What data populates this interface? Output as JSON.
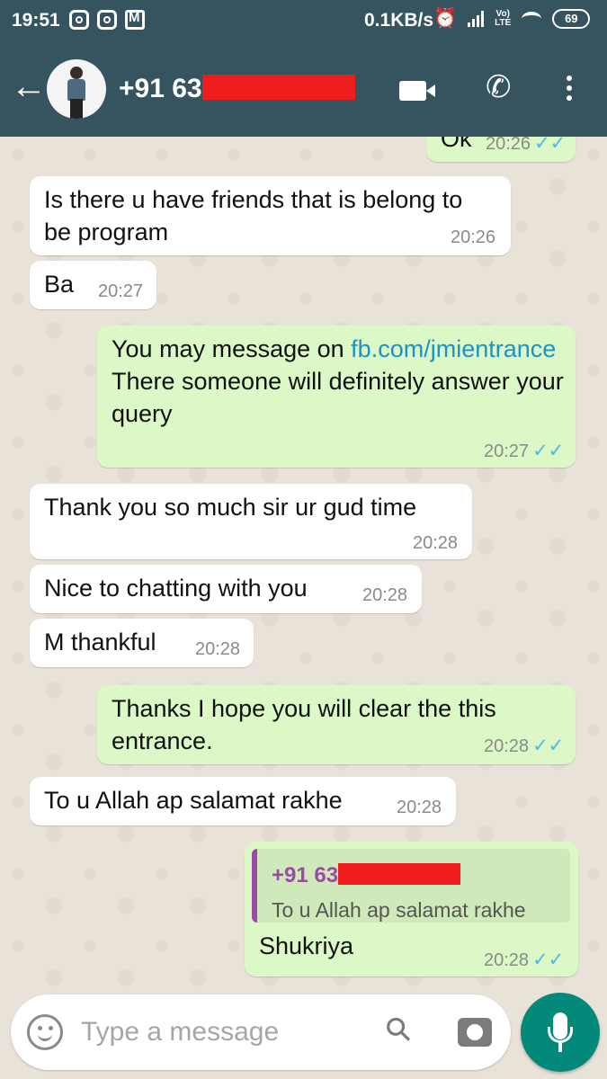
{
  "status_bar": {
    "time": "19:51",
    "network_speed": "0.1KB/s",
    "network_type": "LTE",
    "volte": "Vo)",
    "battery": "69"
  },
  "header": {
    "contact": "+91 63",
    "icons": [
      "back-arrow-icon",
      "avatar",
      "video-call-icon",
      "phone-icon",
      "more-vert-icon"
    ]
  },
  "messages": [
    {
      "direction": "out",
      "text": "Ok",
      "time": "20:26",
      "status": "read"
    },
    {
      "direction": "in",
      "text": "Is there u have friends  that is belong to be program",
      "time": "20:26"
    },
    {
      "direction": "in",
      "text": "Ba",
      "time": "20:27"
    },
    {
      "direction": "out",
      "text_before": "You may message on ",
      "link": "fb.com/jmientrance",
      "text_after": "There someone will definitely answer your query",
      "time": "20:27",
      "status": "read"
    },
    {
      "direction": "in",
      "text": "Thank you so much sir ur gud time",
      "time": "20:28"
    },
    {
      "direction": "in",
      "text": "Nice to chatting with you",
      "time": "20:28"
    },
    {
      "direction": "in",
      "text": "M thankful",
      "time": "20:28"
    },
    {
      "direction": "out",
      "text": "Thanks I hope you will clear the this entrance.",
      "time": "20:28",
      "status": "read"
    },
    {
      "direction": "in",
      "text": "To u Allah ap salamat rakhe",
      "time": "20:28"
    },
    {
      "direction": "out",
      "quoted_name": "+91 63",
      "quoted_text": "To u Allah ap salamat rakhe",
      "text": "Shukriya",
      "time": "20:28",
      "status": "read"
    }
  ],
  "composer": {
    "placeholder": "Type a message"
  },
  "colors": {
    "header": "#35545f",
    "outgoing_bubble": "#dcf8c6",
    "incoming_bubble": "#ffffff",
    "read_ticks": "#4fb6ec",
    "link": "#1a93c9",
    "mic_button": "#03897a",
    "redaction": "#ee1c1c",
    "quote_accent": "#9c4aa6"
  }
}
